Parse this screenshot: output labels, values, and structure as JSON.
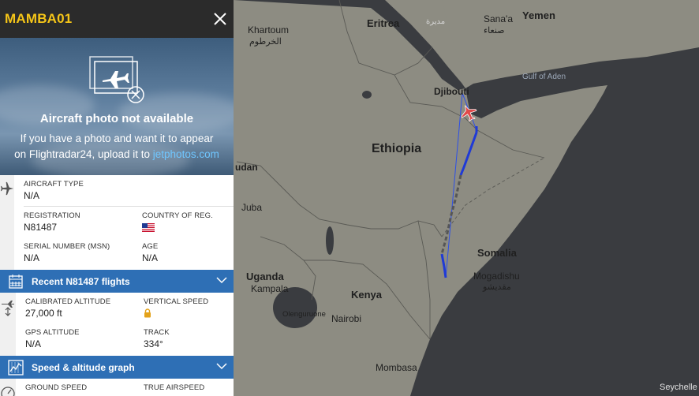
{
  "panel": {
    "callsign": "MAMBA01",
    "photo": {
      "title": "Aircraft photo not available",
      "text_line1": "If you have a photo and want it to appear",
      "text_line2_prefix": "on Flightradar24, upload it to ",
      "link": "jetphotos.com"
    },
    "aircraft_type": {
      "label": "AIRCRAFT TYPE",
      "value": "N/A"
    },
    "registration": {
      "label": "REGISTRATION",
      "value": "N81487"
    },
    "country": {
      "label": "COUNTRY OF REG.",
      "flag": "us-flag"
    },
    "msn": {
      "label": "SERIAL NUMBER (MSN)",
      "value": "N/A"
    },
    "age": {
      "label": "AGE",
      "value": "N/A"
    },
    "recent_flights": "Recent N81487 flights",
    "cal_alt": {
      "label": "CALIBRATED ALTITUDE",
      "value": "27,000 ft"
    },
    "vspeed": {
      "label": "VERTICAL SPEED",
      "icon": "lock-icon"
    },
    "gps_alt": {
      "label": "GPS ALTITUDE",
      "value": "N/A"
    },
    "track": {
      "label": "TRACK",
      "value": "334°"
    },
    "speed_graph": "Speed & altitude graph",
    "ground_speed": {
      "label": "GROUND SPEED"
    },
    "true_airspeed": {
      "label": "TRUE AIRSPEED"
    }
  },
  "map": {
    "labels": {
      "khartoum": "Khartoum",
      "khartoum_ar": "الخرطوم",
      "eritrea": "Eritrea",
      "asmara_ar": "مديرة",
      "sanaa": "Sana'a",
      "sanaa_ar": "صنعاء",
      "yemen": "Yemen",
      "gulf_of_aden": "Gulf of Aden",
      "djibouti": "Djibouti",
      "ethiopia": "Ethiopia",
      "sudan": "udan",
      "juba": "Juba",
      "somalia": "Somalia",
      "mogadishu": "Mogadishu",
      "mogadishu_ar": "مقديشو",
      "uganda": "Uganda",
      "kampala": "Kampala",
      "kenya": "Kenya",
      "olenguruone": "Olenguruone",
      "nairobi": "Nairobi",
      "mombasa": "Mombasa",
      "seychelles": "Seychelle"
    },
    "colors": {
      "land": "#8d8c82",
      "water": "#3a3c40",
      "track": "#1f3ad6",
      "track_faded": "#565656",
      "aircraft": "#e04a4a"
    }
  }
}
